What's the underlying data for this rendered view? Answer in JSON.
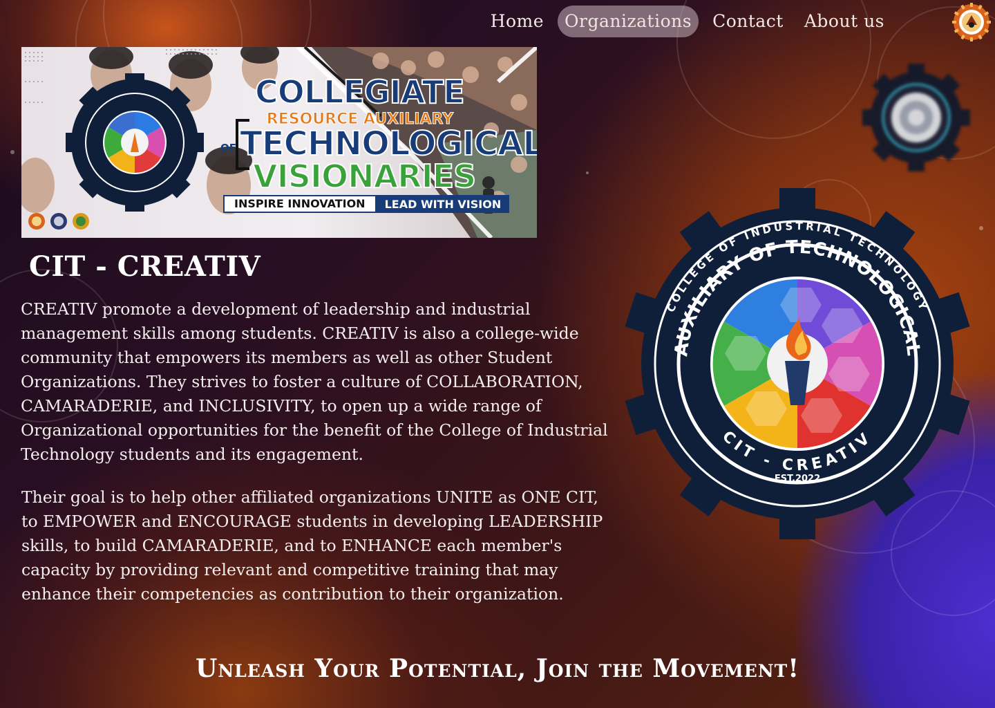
{
  "nav": {
    "items": [
      {
        "label": "Home",
        "active": false
      },
      {
        "label": "Organizations",
        "active": true
      },
      {
        "label": "Contact",
        "active": false
      },
      {
        "label": "About us",
        "active": false
      }
    ]
  },
  "banner": {
    "title_line1": "COLLEGIATE",
    "title_line2": "RESOURCE AUXILIARY",
    "title_of": "OF",
    "title_line3": "TECHNOLOGICAL",
    "title_line4": "VISIONARIES",
    "tag_left": "INSPIRE INNOVATION",
    "tag_right": "LEAD WITH VISION",
    "seal_top_text": "AUXILIARY OF TECHNOLOGICAL",
    "seal_bottom_text": "CIT - CREATIV"
  },
  "org": {
    "title": "CIT - CREATIV",
    "paragraph1": "CREATIV promote a development of leadership and industrial management skills among students. CREATIV is also a college-wide community that empowers its members as well as other Student Organizations. They strives to foster a culture of COLLABORATION, CAMARADERIE, and INCLUSIVITY, to open up a wide range of Organizational opportunities for the benefit of the College of Industrial Technology students and its engagement.",
    "paragraph2": "Their goal is to help other affiliated organizations UNITE as ONE CIT, to EMPOWER and ENCOURAGE students in developing LEADERSHIP skills, to build CAMARADERIE, and to ENHANCE each member's capacity by providing relevant and competitive training that may enhance their competencies as contribution to their organization."
  },
  "seal": {
    "outer_top": "INDUSTRIAL TECHNOLOGY",
    "outer_left": "COLLEGE OF",
    "ring_text": "COLLEGIATE RESOURCE AUXILIARY OF TECHNOLOGICAL VISIONARIES",
    "est": "EST.2022",
    "bottom": "CIT - CREATIV"
  },
  "slogan": "Unleash Your Potential, Join the Movement!",
  "colors": {
    "navy": "#0f1f3a",
    "banner_blue": "#173c78",
    "orange": "#e47a18",
    "green": "#3aa23a",
    "nav_active_bg": "#b8a4ae"
  }
}
